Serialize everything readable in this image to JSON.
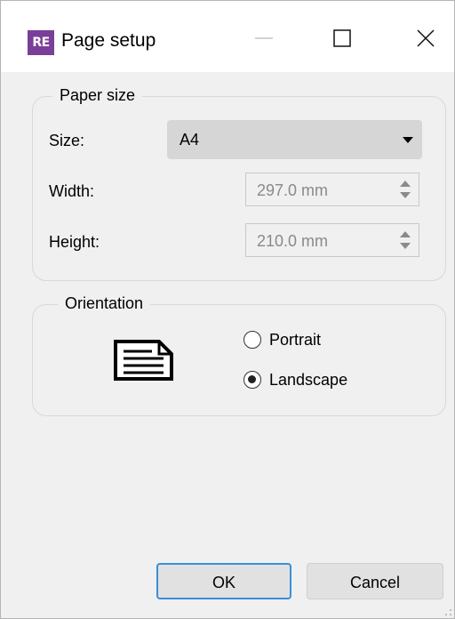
{
  "window": {
    "title": "Page setup",
    "app_icon_text": "RE",
    "app_icon_color": "#7a3f98"
  },
  "paper_size": {
    "legend": "Paper size",
    "size_label": "Size:",
    "size_value": "A4",
    "width_label": "Width:",
    "width_value": "297.0 mm",
    "height_label": "Height:",
    "height_value": "210.0 mm"
  },
  "orientation": {
    "legend": "Orientation",
    "options": [
      {
        "label": "Portrait",
        "selected": false
      },
      {
        "label": "Landscape",
        "selected": true
      }
    ]
  },
  "buttons": {
    "ok": "OK",
    "cancel": "Cancel"
  },
  "colors": {
    "focus_border": "#3a8fd8",
    "dialog_bg": "#f0f0f0"
  }
}
